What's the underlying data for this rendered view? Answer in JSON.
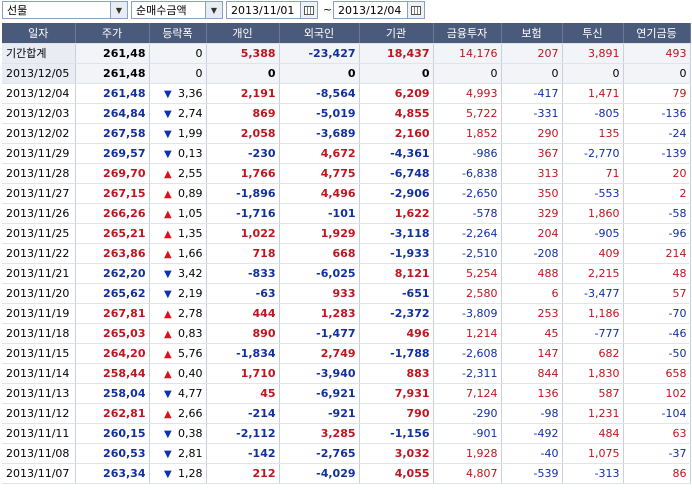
{
  "toolbar": {
    "market": "선물",
    "metric": "순매수금액",
    "start_date": "2013/11/01",
    "end_date": "2013/12/04",
    "separator": "~"
  },
  "columns": [
    "일자",
    "주가",
    "등락폭",
    "개인",
    "외국인",
    "기관",
    "금융투자",
    "보험",
    "투신",
    "연기금등"
  ],
  "summary": [
    {
      "date": "기간합계",
      "price": "261,48",
      "dir": "",
      "change": "0",
      "indiv": "5,388",
      "foreign": "-23,427",
      "inst": "18,437",
      "fin": "14,176",
      "ins": "207",
      "trust": "3,891",
      "pension": "493"
    },
    {
      "date": "2013/12/05",
      "price": "261,48",
      "dir": "",
      "change": "0",
      "indiv": "0",
      "foreign": "0",
      "inst": "0",
      "fin": "0",
      "ins": "0",
      "trust": "0",
      "pension": "0"
    }
  ],
  "rows": [
    {
      "date": "2013/12/04",
      "price": "261,48",
      "dir": "down",
      "change": "3,36",
      "indiv": "2,191",
      "foreign": "-8,564",
      "inst": "6,209",
      "fin": "4,993",
      "ins": "-417",
      "trust": "1,471",
      "pension": "79"
    },
    {
      "date": "2013/12/03",
      "price": "264,84",
      "dir": "down",
      "change": "2,74",
      "indiv": "869",
      "foreign": "-5,019",
      "inst": "4,855",
      "fin": "5,722",
      "ins": "-331",
      "trust": "-805",
      "pension": "-136"
    },
    {
      "date": "2013/12/02",
      "price": "267,58",
      "dir": "down",
      "change": "1,99",
      "indiv": "2,058",
      "foreign": "-3,689",
      "inst": "2,160",
      "fin": "1,852",
      "ins": "290",
      "trust": "135",
      "pension": "-24"
    },
    {
      "date": "2013/11/29",
      "price": "269,57",
      "dir": "down",
      "change": "0,13",
      "indiv": "-230",
      "foreign": "4,672",
      "inst": "-4,361",
      "fin": "-986",
      "ins": "367",
      "trust": "-2,770",
      "pension": "-139"
    },
    {
      "date": "2013/11/28",
      "price": "269,70",
      "dir": "up",
      "change": "2,55",
      "indiv": "1,766",
      "foreign": "4,775",
      "inst": "-6,748",
      "fin": "-6,838",
      "ins": "313",
      "trust": "71",
      "pension": "20"
    },
    {
      "date": "2013/11/27",
      "price": "267,15",
      "dir": "up",
      "change": "0,89",
      "indiv": "-1,896",
      "foreign": "4,496",
      "inst": "-2,906",
      "fin": "-2,650",
      "ins": "350",
      "trust": "-553",
      "pension": "2"
    },
    {
      "date": "2013/11/26",
      "price": "266,26",
      "dir": "up",
      "change": "1,05",
      "indiv": "-1,716",
      "foreign": "-101",
      "inst": "1,622",
      "fin": "-578",
      "ins": "329",
      "trust": "1,860",
      "pension": "-58"
    },
    {
      "date": "2013/11/25",
      "price": "265,21",
      "dir": "up",
      "change": "1,35",
      "indiv": "1,022",
      "foreign": "1,929",
      "inst": "-3,118",
      "fin": "-2,264",
      "ins": "204",
      "trust": "-905",
      "pension": "-96"
    },
    {
      "date": "2013/11/22",
      "price": "263,86",
      "dir": "up",
      "change": "1,66",
      "indiv": "718",
      "foreign": "668",
      "inst": "-1,933",
      "fin": "-2,510",
      "ins": "-208",
      "trust": "409",
      "pension": "214"
    },
    {
      "date": "2013/11/21",
      "price": "262,20",
      "dir": "down",
      "change": "3,42",
      "indiv": "-833",
      "foreign": "-6,025",
      "inst": "8,121",
      "fin": "5,254",
      "ins": "488",
      "trust": "2,215",
      "pension": "48"
    },
    {
      "date": "2013/11/20",
      "price": "265,62",
      "dir": "down",
      "change": "2,19",
      "indiv": "-63",
      "foreign": "933",
      "inst": "-651",
      "fin": "2,580",
      "ins": "6",
      "trust": "-3,477",
      "pension": "57"
    },
    {
      "date": "2013/11/19",
      "price": "267,81",
      "dir": "up",
      "change": "2,78",
      "indiv": "444",
      "foreign": "1,283",
      "inst": "-2,372",
      "fin": "-3,809",
      "ins": "253",
      "trust": "1,186",
      "pension": "-70"
    },
    {
      "date": "2013/11/18",
      "price": "265,03",
      "dir": "up",
      "change": "0,83",
      "indiv": "890",
      "foreign": "-1,477",
      "inst": "496",
      "fin": "1,214",
      "ins": "45",
      "trust": "-777",
      "pension": "-46"
    },
    {
      "date": "2013/11/15",
      "price": "264,20",
      "dir": "up",
      "change": "5,76",
      "indiv": "-1,834",
      "foreign": "2,749",
      "inst": "-1,788",
      "fin": "-2,608",
      "ins": "147",
      "trust": "682",
      "pension": "-50"
    },
    {
      "date": "2013/11/14",
      "price": "258,44",
      "dir": "up",
      "change": "0,40",
      "indiv": "1,710",
      "foreign": "-3,940",
      "inst": "883",
      "fin": "-2,311",
      "ins": "844",
      "trust": "1,830",
      "pension": "658"
    },
    {
      "date": "2013/11/13",
      "price": "258,04",
      "dir": "down",
      "change": "4,77",
      "indiv": "45",
      "foreign": "-6,921",
      "inst": "7,931",
      "fin": "7,124",
      "ins": "136",
      "trust": "587",
      "pension": "102"
    },
    {
      "date": "2013/11/12",
      "price": "262,81",
      "dir": "up",
      "change": "2,66",
      "indiv": "-214",
      "foreign": "-921",
      "inst": "790",
      "fin": "-290",
      "ins": "-98",
      "trust": "1,231",
      "pension": "-104"
    },
    {
      "date": "2013/11/11",
      "price": "260,15",
      "dir": "down",
      "change": "0,38",
      "indiv": "-2,112",
      "foreign": "3,285",
      "inst": "-1,156",
      "fin": "-901",
      "ins": "-492",
      "trust": "484",
      "pension": "63"
    },
    {
      "date": "2013/11/08",
      "price": "260,53",
      "dir": "down",
      "change": "2,81",
      "indiv": "-142",
      "foreign": "-2,765",
      "inst": "3,032",
      "fin": "1,928",
      "ins": "-40",
      "trust": "1,075",
      "pension": "-37"
    },
    {
      "date": "2013/11/07",
      "price": "263,34",
      "dir": "down",
      "change": "1,28",
      "indiv": "212",
      "foreign": "-4,029",
      "inst": "4,055",
      "fin": "4,807",
      "ins": "-539",
      "trust": "-313",
      "pension": "86"
    }
  ],
  "colors": {
    "header_bg": "#4a5a7a",
    "positive": "#c0141e",
    "negative": "#102fa0",
    "up_arrow": "#e0101a",
    "down_arrow": "#1030b8"
  },
  "icons": {
    "up": "▲",
    "down": "▼",
    "dropdown": "chevron-down-icon",
    "calendar": "calendar-icon"
  }
}
